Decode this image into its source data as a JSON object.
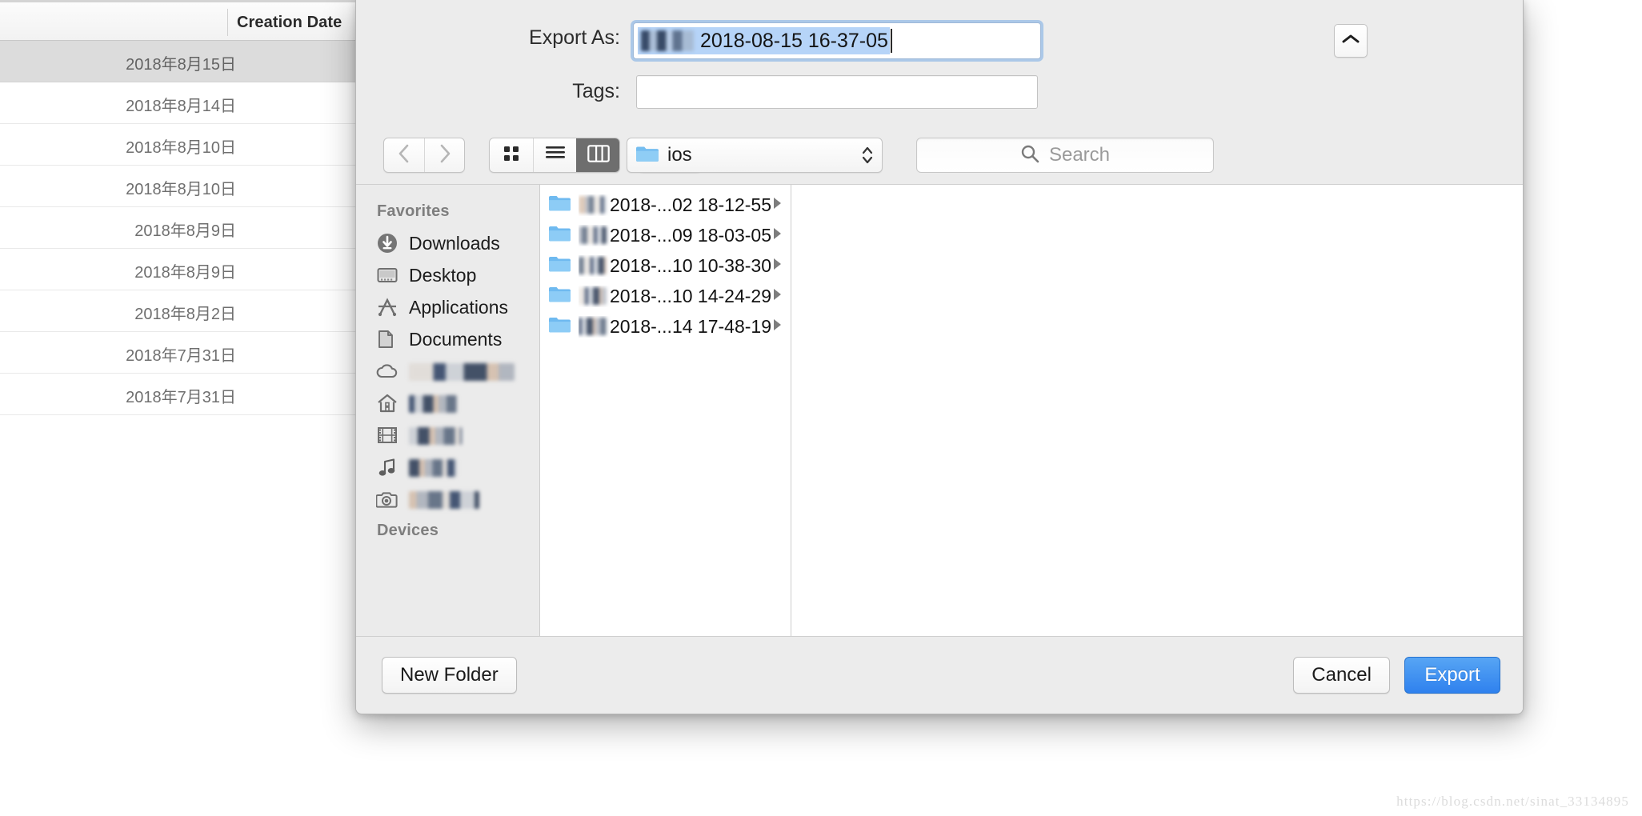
{
  "background_window": {
    "column_header": "Creation Date",
    "rows": [
      {
        "date": "2018年8月15日",
        "selected": true
      },
      {
        "date": "2018年8月14日",
        "selected": false
      },
      {
        "date": "2018年8月10日",
        "selected": false
      },
      {
        "date": "2018年8月10日",
        "selected": false
      },
      {
        "date": "2018年8月9日",
        "selected": false
      },
      {
        "date": "2018年8月9日",
        "selected": false
      },
      {
        "date": "2018年8月2日",
        "selected": false
      },
      {
        "date": "2018年7月31日",
        "selected": false
      },
      {
        "date": "2018年7月31日",
        "selected": false
      }
    ]
  },
  "dialog": {
    "export_as": {
      "label": "Export As:",
      "value": "2018-08-15 16-37-05",
      "redacted_prefix": true,
      "selected": true
    },
    "tags": {
      "label": "Tags:",
      "value": "",
      "placeholder": ""
    },
    "disclosure_button": {
      "icon": "chevron-up-icon"
    },
    "toolbar": {
      "back_icon": "chevron-left-icon",
      "forward_icon": "chevron-right-icon",
      "view_modes": [
        {
          "name": "icon-view",
          "icon": "grid-icon",
          "active": false
        },
        {
          "name": "list-view",
          "icon": "list-icon",
          "active": false
        },
        {
          "name": "column-view",
          "icon": "columns-icon",
          "active": true
        }
      ],
      "arrange": {
        "icon": "arrange-icon",
        "chevron": "chevron-down-icon"
      },
      "path_popup": {
        "icon": "folder-icon",
        "label": "ios",
        "stepper": "up-down-icon"
      },
      "search": {
        "icon": "search-icon",
        "placeholder": "Search",
        "value": ""
      }
    },
    "sidebar": {
      "sections": [
        {
          "title": "Favorites",
          "items": [
            {
              "label": "Downloads",
              "icon": "download-circle-icon",
              "redacted": false
            },
            {
              "label": "Desktop",
              "icon": "desktop-icon",
              "redacted": false
            },
            {
              "label": "Applications",
              "icon": "applications-icon",
              "redacted": false
            },
            {
              "label": "Documents",
              "icon": "documents-icon",
              "redacted": false
            },
            {
              "label": "iCloud Drive",
              "icon": "cloud-icon",
              "redacted": true
            },
            {
              "label": "Home",
              "icon": "home-icon",
              "redacted": true
            },
            {
              "label": "Movies",
              "icon": "movies-icon",
              "redacted": true
            },
            {
              "label": "Music",
              "icon": "music-icon",
              "redacted": true
            },
            {
              "label": "Pictures",
              "icon": "pictures-icon",
              "redacted": true
            }
          ]
        },
        {
          "title": "Devices",
          "items": []
        }
      ]
    },
    "file_list": [
      {
        "name": "2018-...02 18-12-55",
        "icon": "folder-icon",
        "chevron": "chevron-right-icon",
        "redacted_prefix": true
      },
      {
        "name": "2018-...09 18-03-05",
        "icon": "folder-icon",
        "chevron": "chevron-right-icon",
        "redacted_prefix": true
      },
      {
        "name": "2018-...10 10-38-30",
        "icon": "folder-icon",
        "chevron": "chevron-right-icon",
        "redacted_prefix": true
      },
      {
        "name": "2018-...10 14-24-29",
        "icon": "folder-icon",
        "chevron": "chevron-right-icon",
        "redacted_prefix": true
      },
      {
        "name": "2018-...14 17-48-19",
        "icon": "folder-icon",
        "chevron": "chevron-right-icon",
        "redacted_prefix": true
      }
    ],
    "buttons": {
      "new_folder": "New Folder",
      "cancel": "Cancel",
      "export": "Export"
    }
  },
  "watermark": "https://blog.csdn.net/sinat_33134895",
  "colors": {
    "accent_blue": "#2f81ee",
    "selection_blue": "#b6d4f8",
    "folder_blue": "#6cb8ef",
    "sheet_bg": "#ececec",
    "active_segment": "#6e6e6e"
  }
}
